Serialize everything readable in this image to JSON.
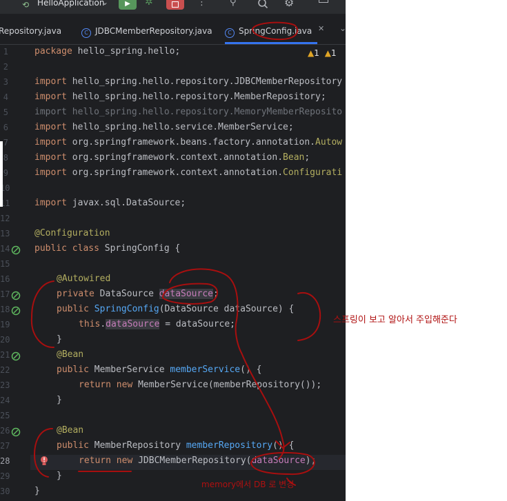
{
  "toolbar": {
    "run_config": "HelloApplication"
  },
  "tabs": [
    {
      "label": "Repository.java"
    },
    {
      "label": "JDBCMemberRepository.java"
    },
    {
      "label": "SpringConfig.java"
    }
  ],
  "warnings": {
    "count1": "1",
    "count2": "1"
  },
  "code": {
    "line_numbers": [
      "1",
      "2",
      "3",
      "4",
      "5",
      "6",
      "7",
      "8",
      "9",
      "10",
      "11",
      "12",
      "13",
      "14",
      "15",
      "16",
      "17",
      "18",
      "19",
      "20",
      "21",
      "22",
      "23",
      "24",
      "25",
      "26",
      "27",
      "28",
      "29",
      "30"
    ],
    "l1_kw": "package",
    "l1_rest": " hello_spring.hello;",
    "imp": "import",
    "l3": " hello_spring.hello.repository.JDBCMemberRepository",
    "l4": " hello_spring.hello.repository.MemberRepository;",
    "l5": " hello_spring.hello.repository.MemoryMemberReposito",
    "l6": " hello_spring.hello.service.MemberService;",
    "l7_a": " org.springframework.beans.factory.annotation.",
    "l7_b": "Autow",
    "l8_a": " org.springframework.context.annotation.",
    "l8_b": "Bean",
    "l8_c": ";",
    "l9_a": " org.springframework.context.annotation.",
    "l9_b": "Configurati",
    "l11": " javax.sql.DataSource;",
    "l13": "@Configuration",
    "l14_kw": "public class",
    "l14_rest": " SpringConfig {",
    "l16": "@Autowired",
    "l17_kw": "private",
    "l17_type": " DataSource ",
    "l17_field": "dataSource",
    "l17_end": ";",
    "l18_kw": "public",
    "l18_fn": "SpringConfig",
    "l18_rest": "(DataSource dataSource) {",
    "l19_kw": "this",
    "l19_field": "dataSource",
    "l19_rest": " = dataSource;",
    "close": "}",
    "bean": "@Bean",
    "l22_kw": "public",
    "l22_type": " MemberService ",
    "l22_fn": "memberService",
    "l22_rest": "() {",
    "l23_kw": "return new",
    "l23_rest": " MemberService(memberRepository());",
    "l27_kw": "public",
    "l27_type": " MemberRepository ",
    "l27_fn": "memberRepository",
    "l27_rest": "() {",
    "l28_kw": "return new",
    "l28_a": " JDBCMemberRepository(",
    "l28_b": "dataSource",
    "l28_c": ");"
  },
  "annotations": {
    "note1": "스프링이 보고 알아서 주입해준다",
    "note2": "memory에서 DB 로 변경"
  },
  "colors": {
    "ink": "#b01010",
    "accent": "#3574f0",
    "background": "#1e1f22"
  }
}
